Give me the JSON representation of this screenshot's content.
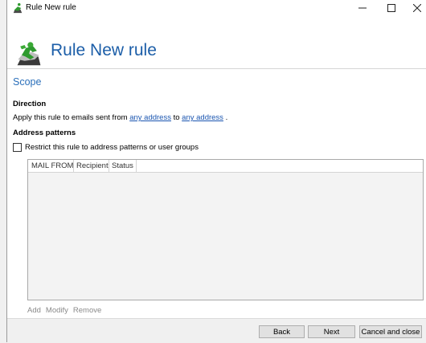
{
  "window": {
    "title": "Rule New rule"
  },
  "header": {
    "title": "Rule New rule"
  },
  "scope": {
    "title": "Scope",
    "direction_label": "Direction",
    "apply_prefix": "Apply this rule to emails sent from ",
    "from_link": "any address",
    "apply_middle": " to ",
    "to_link": "any address",
    "apply_suffix": " .",
    "address_patterns_label": "Address patterns",
    "restrict_checkbox_label": "Restrict this rule to address patterns or user groups",
    "restrict_checked": false
  },
  "table": {
    "columns": [
      "MAIL FROM",
      "Recipient",
      "Status"
    ],
    "rows": []
  },
  "list_actions": {
    "add": "Add",
    "modify": "Modify",
    "remove": "Remove"
  },
  "footer": {
    "back": "Back",
    "next": "Next",
    "cancel": "Cancel and close"
  },
  "icons": {
    "app": "running-man-icon"
  },
  "colors": {
    "header_title": "#1c5ea8",
    "section_title": "#2a6fba",
    "link": "#1a55b0"
  }
}
